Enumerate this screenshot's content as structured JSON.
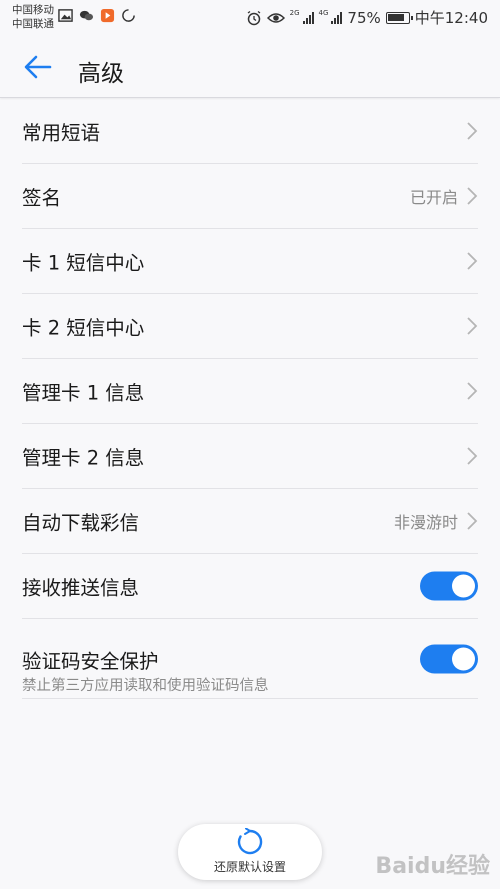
{
  "status_bar": {
    "carrier_1": "中国移动",
    "carrier_2": "中国联通",
    "net_1": "2G",
    "net_2": "4G",
    "battery": "75%",
    "time": "中午12:40"
  },
  "header": {
    "title": "高级"
  },
  "settings": [
    {
      "label": "常用短语",
      "value": ""
    },
    {
      "label": "签名",
      "value": "已开启"
    },
    {
      "label": "卡 1 短信中心",
      "value": ""
    },
    {
      "label": "卡 2 短信中心",
      "value": ""
    },
    {
      "label": "管理卡 1 信息",
      "value": ""
    },
    {
      "label": "管理卡 2 信息",
      "value": ""
    },
    {
      "label": "自动下载彩信",
      "value": "非漫游时"
    }
  ],
  "toggles": [
    {
      "label": "接收推送信息",
      "subtitle": "",
      "on": true
    },
    {
      "label": "验证码安全保护",
      "subtitle": "禁止第三方应用读取和使用验证码信息",
      "on": true
    }
  ],
  "reset_button": {
    "label": "还原默认设置"
  },
  "watermark": "Baidu经验",
  "colors": {
    "accent": "#1e7ef0",
    "background": "#f8f8fa"
  }
}
